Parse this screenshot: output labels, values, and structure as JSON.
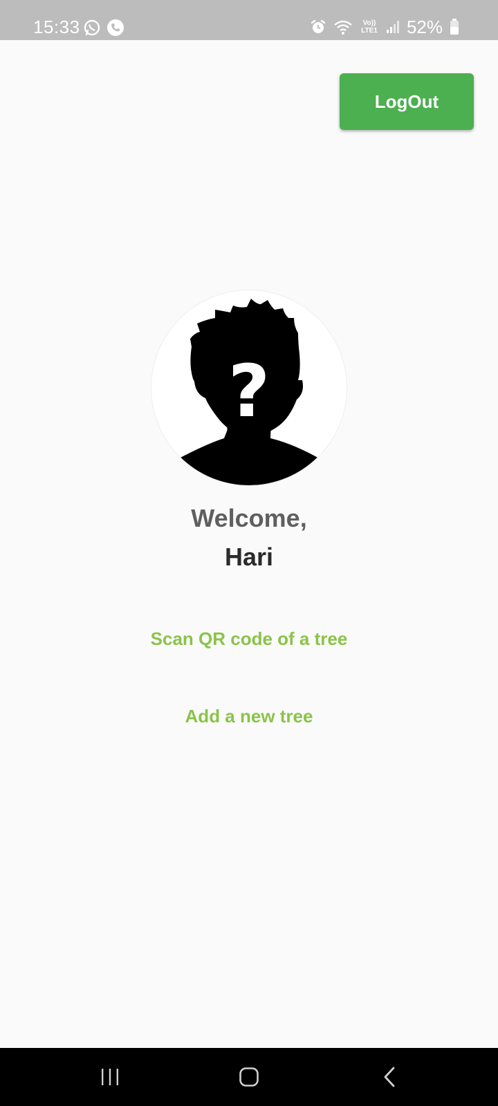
{
  "status_bar": {
    "time": "15:33",
    "battery": "52%",
    "network_label": "Vo)) LTE1",
    "left_icons": [
      "whatsapp-icon",
      "call-icon"
    ],
    "right_icons": [
      "alarm-icon",
      "wifi-icon",
      "volte-icon",
      "signal-icon",
      "battery-icon"
    ]
  },
  "app": {
    "logout_label": "LogOut",
    "avatar_icon": "unknown-user-silhouette",
    "welcome_text": "Welcome,",
    "username": "Hari",
    "scan_link": "Scan QR code of a tree",
    "add_link": "Add a new tree"
  },
  "colors": {
    "accent_button": "#4caf50",
    "link": "#8bc34a",
    "status_bar": "#bcbcbc",
    "background": "#fafafa"
  },
  "nav_bar": {
    "buttons": [
      "recent-apps-icon",
      "home-icon",
      "back-icon"
    ]
  }
}
